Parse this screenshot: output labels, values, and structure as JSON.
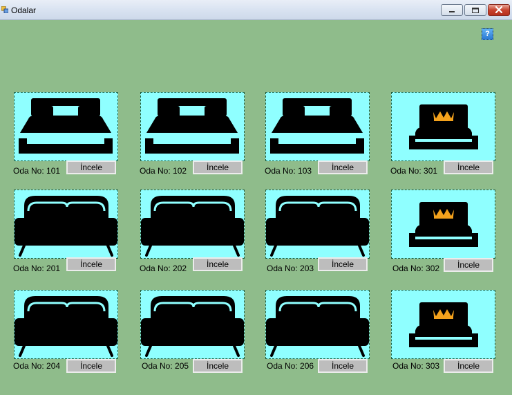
{
  "window": {
    "title": "Odalar"
  },
  "help": {
    "label": "?"
  },
  "rooms": [
    {
      "label": "Oda No: 101",
      "button": "İncele",
      "icon": "double-bed-icon"
    },
    {
      "label": "Oda No: 102",
      "button": "İncele",
      "icon": "double-bed-icon"
    },
    {
      "label": "Oda No: 103",
      "button": "İncele",
      "icon": "double-bed-icon"
    },
    {
      "label": "Oda No: 301",
      "button": "İncele",
      "icon": "king-bed-icon"
    },
    {
      "label": "Oda No: 201",
      "button": "İncele",
      "icon": "wide-bed-icon"
    },
    {
      "label": "Oda No: 202",
      "button": "İncele",
      "icon": "wide-bed-icon"
    },
    {
      "label": "Oda No: 203",
      "button": "İncele",
      "icon": "wide-bed-icon"
    },
    {
      "label": "Oda No: 302",
      "button": "İncele",
      "icon": "king-bed-icon"
    },
    {
      "label": "Oda No: 204",
      "button": "İncele",
      "icon": "wide-bed-icon"
    },
    {
      "label": "Oda No: 205",
      "button": "İncele",
      "icon": "wide-bed-icon"
    },
    {
      "label": "Oda No: 206",
      "button": "İncele",
      "icon": "wide-bed-icon"
    },
    {
      "label": "Oda No: 303",
      "button": "İncele",
      "icon": "king-bed-icon"
    }
  ],
  "colors": {
    "card_bg": "#8fffff",
    "form_bg": "#8fbc8b",
    "crown": "#f4a21c"
  }
}
